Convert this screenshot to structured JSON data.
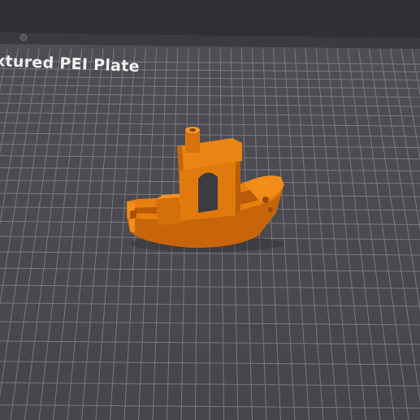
{
  "viewport": {
    "plate_label": "xtured PEI Plate",
    "model_name": "benchy-boat",
    "colors": {
      "background": "#434348",
      "bed_frame": "#303034",
      "bed_top": "#4b4b50",
      "grid_line": "#8a8a90",
      "model_orange": "#e87f0c"
    }
  }
}
